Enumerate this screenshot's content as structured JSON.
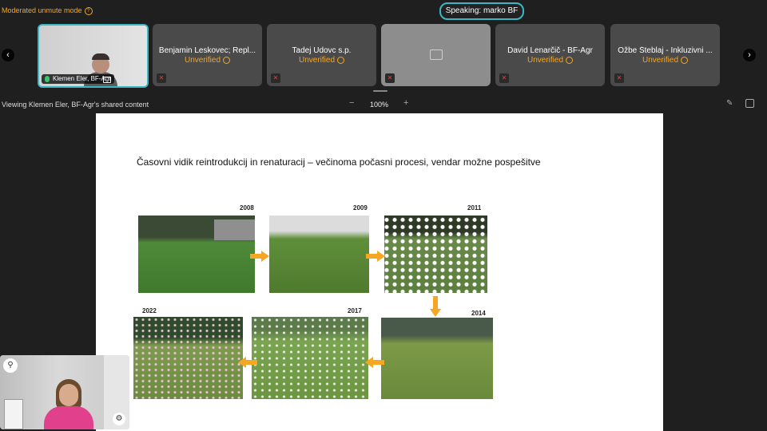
{
  "topbar": {
    "mode_text": "Moderated unmute mode",
    "speaking": "Speaking: marko BF"
  },
  "participants": [
    {
      "name": "Klemen Eler, BF-Agr",
      "status": "",
      "active": true
    },
    {
      "name": "Benjamin Leskovec; Repl...",
      "status": "Unverified"
    },
    {
      "name": "Tadej Udovc s.p.",
      "status": "Unverified"
    },
    {
      "name": "",
      "status": ""
    },
    {
      "name": "David Lenarčič - BF-Agr",
      "status": "Unverified"
    },
    {
      "name": "Ožbe Šteblaj - Inkluzivni ...",
      "status": "Unverified"
    }
  ],
  "share": {
    "viewing": "Viewing Klemen Eler, BF-Agr's shared content",
    "zoom": "100%"
  },
  "slide": {
    "title": "Časovni vidik reintrodukcij in renaturacij – večinoma počasni procesi, vendar možne pospešitve",
    "years": [
      "2008",
      "2009",
      "2011",
      "2014",
      "2017",
      "2022"
    ]
  },
  "icons": {
    "prev": "chevron-left-icon",
    "next": "chevron-right-icon",
    "muted": "mic-off-icon",
    "pin": "pin-icon",
    "settings": "gear-icon"
  },
  "colors": {
    "accent": "#3bb7c4",
    "warning": "#f5a623",
    "muted": "#e0443c"
  }
}
